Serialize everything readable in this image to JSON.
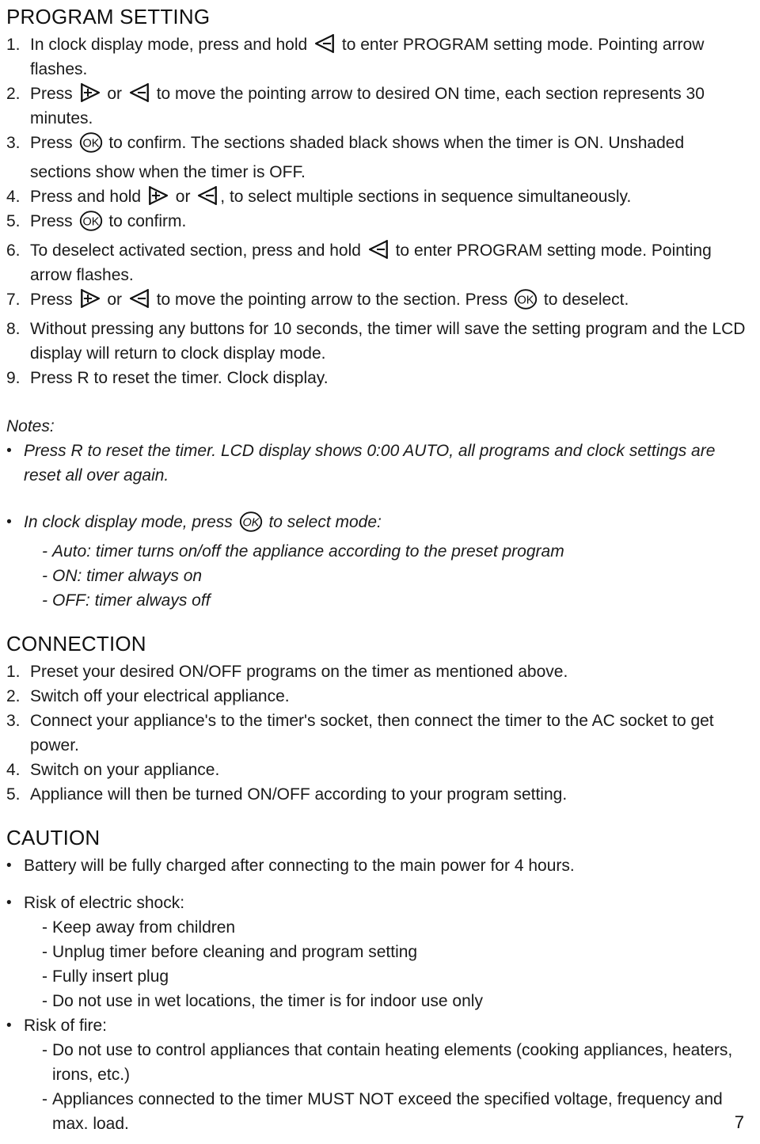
{
  "document": {
    "page_number": "7"
  },
  "program_setting": {
    "title": "PROGRAM SETTING",
    "steps": [
      {
        "num": "1.",
        "parts": [
          {
            "type": "text",
            "text": "In clock display mode, press and hold "
          },
          {
            "type": "icon",
            "icon": "minus-arrow-key"
          },
          {
            "type": "text",
            "text": " to enter PROGRAM setting mode. Pointing arrow flashes."
          }
        ]
      },
      {
        "num": "2.",
        "parts": [
          {
            "type": "text",
            "text": "Press "
          },
          {
            "type": "icon",
            "icon": "plus-arrow-key"
          },
          {
            "type": "text",
            "text": " or "
          },
          {
            "type": "icon",
            "icon": "minus-arrow-key"
          },
          {
            "type": "text",
            "text": " to move the pointing arrow to desired ON time, each section represents 30 minutes."
          }
        ]
      },
      {
        "num": "3.",
        "parts": [
          {
            "type": "text",
            "text": "Press "
          },
          {
            "type": "icon",
            "icon": "ok-key"
          },
          {
            "type": "text",
            "text": " to confirm. The sections shaded black shows when the timer is ON. Unshaded sections show when the timer is OFF."
          }
        ]
      },
      {
        "num": "4.",
        "parts": [
          {
            "type": "text",
            "text": "Press and hold "
          },
          {
            "type": "icon",
            "icon": "plus-arrow-key"
          },
          {
            "type": "text",
            "text": " or "
          },
          {
            "type": "icon",
            "icon": "minus-arrow-key"
          },
          {
            "type": "text",
            "text": ",  to select multiple sections in sequence simultaneously."
          }
        ]
      },
      {
        "num": "5.",
        "parts": [
          {
            "type": "text",
            "text": "Press "
          },
          {
            "type": "icon",
            "icon": "ok-key"
          },
          {
            "type": "text",
            "text": " to confirm."
          }
        ]
      },
      {
        "num": "6.",
        "parts": [
          {
            "type": "text",
            "text": "To deselect activated section, press and hold "
          },
          {
            "type": "icon",
            "icon": "minus-arrow-key"
          },
          {
            "type": "text",
            "text": " to enter PROGRAM setting mode. Pointing arrow flashes."
          }
        ]
      },
      {
        "num": "7.",
        "parts": [
          {
            "type": "text",
            "text": "Press "
          },
          {
            "type": "icon",
            "icon": "plus-arrow-key"
          },
          {
            "type": "text",
            "text": " or "
          },
          {
            "type": "icon",
            "icon": "minus-arrow-key"
          },
          {
            "type": "text",
            "text": " to move the pointing arrow to the section. Press "
          },
          {
            "type": "icon",
            "icon": "ok-key"
          },
          {
            "type": "text",
            "text": " to deselect."
          }
        ]
      },
      {
        "num": "8.",
        "parts": [
          {
            "type": "text",
            "text": "Without pressing any buttons for 10 seconds, the timer will save the setting program and the LCD display will return to clock display mode."
          }
        ]
      },
      {
        "num": "9.",
        "parts": [
          {
            "type": "text",
            "text": "Press R to reset the timer. Clock display."
          }
        ]
      }
    ]
  },
  "notes": {
    "label": "Notes:",
    "bullet_glyph": "•",
    "items": [
      {
        "parts": [
          {
            "type": "text",
            "text": "Press R to reset the timer. LCD display shows 0:00 AUTO, all programs and clock settings are reset all over again."
          }
        ],
        "sub_items": []
      },
      {
        "parts": [
          {
            "type": "text",
            "text": "In clock display mode, press "
          },
          {
            "type": "icon",
            "icon": "ok-key"
          },
          {
            "type": "text",
            "text": " to select mode:"
          }
        ],
        "sub_items": [
          "Auto: timer turns on/off the appliance according to the preset program",
          "ON: timer always on",
          "OFF: timer always off"
        ]
      }
    ],
    "dash_glyph": "-"
  },
  "connection": {
    "title": "CONNECTION",
    "steps": [
      {
        "num": "1.",
        "text": "Preset your desired ON/OFF programs on the timer as mentioned above."
      },
      {
        "num": "2.",
        "text": "Switch off your electrical appliance."
      },
      {
        "num": "3.",
        "text": "Connect your appliance's to the timer's socket, then connect the timer to the AC socket to get power."
      },
      {
        "num": "4.",
        "text": "Switch on your appliance."
      },
      {
        "num": "5.",
        "text": "Appliance will then be turned ON/OFF according to your program setting."
      }
    ]
  },
  "caution": {
    "title": "CAUTION",
    "bullet_glyph": "•",
    "dash_glyph": "-",
    "items": [
      {
        "text": "Battery will be fully charged after connecting to the main power for 4 hours.",
        "sub_items": []
      },
      {
        "text": "Risk of electric shock:",
        "sub_items": [
          "Keep away from children",
          "Unplug timer before cleaning and program setting",
          "Fully insert plug",
          "Do not use in wet locations, the timer is for indoor use only"
        ]
      },
      {
        "text": "Risk of fire:",
        "sub_items": [
          "Do not use to control appliances that contain heating elements (cooking appliances, heaters, irons, etc.)",
          "Appliances connected to the timer MUST NOT exceed the specified voltage, frequency and max. load."
        ]
      }
    ]
  },
  "icons": {
    "plus_arrow_key": "plus-arrow-key",
    "minus_arrow_key": "minus-arrow-key",
    "ok_key": "ok-key"
  },
  "colors": {
    "text": "#1a1a1a",
    "background": "#ffffff"
  }
}
